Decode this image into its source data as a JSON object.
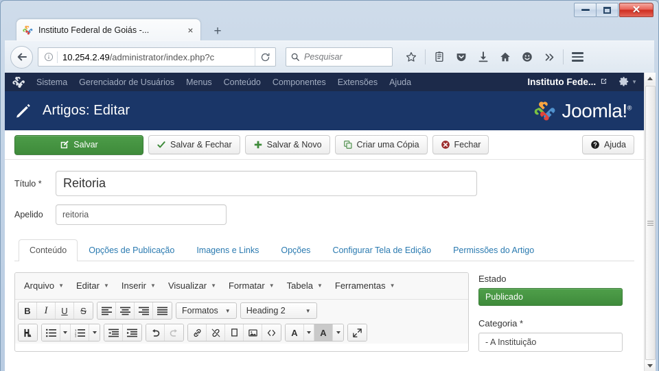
{
  "window": {
    "minimize_label": "Minimizar",
    "maximize_label": "Maximizar",
    "close_label": "Fechar"
  },
  "browser": {
    "tab": {
      "title": "Instituto Federal de Goiás -...",
      "favicon": "joomla-icon",
      "close_label": "×"
    },
    "new_tab_label": "+",
    "back_label": "←",
    "url": "10.254.2.49",
    "url_path": "/administrator/index.php?c",
    "reload_label": "⟳",
    "search_placeholder": "Pesquisar",
    "toolbar_icons": [
      "star-icon",
      "reader-list-icon",
      "pocket-icon",
      "download-icon",
      "home-icon",
      "smiley-icon",
      "overflow-chevrons-icon",
      "hamburger-menu-icon"
    ]
  },
  "joomla": {
    "nav": {
      "logo": "joomla-logo-icon",
      "items": [
        {
          "label": "Sistema"
        },
        {
          "label": "Gerenciador de Usuários"
        },
        {
          "label": "Menus"
        },
        {
          "label": "Conteúdo"
        },
        {
          "label": "Componentes"
        },
        {
          "label": "Extensões"
        },
        {
          "label": "Ajuda"
        }
      ],
      "site_name": "Instituto Fede...",
      "external_icon": "external-link-icon",
      "gear_icon": "gear-icon",
      "caret_icon": "chevron-down-icon"
    },
    "header": {
      "icon": "pencil-icon",
      "title": "Artigos: Editar",
      "brand": "Joomla!",
      "brand_sup": "®"
    },
    "toolbar": {
      "save": "Salvar",
      "save_close": "Salvar & Fechar",
      "save_new": "Salvar & Novo",
      "copy": "Criar uma Cópia",
      "close": "Fechar",
      "help": "Ajuda"
    },
    "form": {
      "title_label": "Título *",
      "title_value": "Reitoria",
      "alias_label": "Apelido",
      "alias_value": "reitoria"
    },
    "tabs": [
      {
        "label": "Conteúdo",
        "active": true
      },
      {
        "label": "Opções de Publicação",
        "active": false
      },
      {
        "label": "Imagens e Links",
        "active": false
      },
      {
        "label": "Opções",
        "active": false
      },
      {
        "label": "Configurar Tela de Edição",
        "active": false
      },
      {
        "label": "Permissões do Artigo",
        "active": false
      }
    ],
    "editor": {
      "menubar": [
        {
          "label": "Arquivo"
        },
        {
          "label": "Editar"
        },
        {
          "label": "Inserir"
        },
        {
          "label": "Visualizar"
        },
        {
          "label": "Formatar"
        },
        {
          "label": "Tabela"
        },
        {
          "label": "Ferramentas"
        }
      ],
      "format_select": "Formatos",
      "heading_select": "Heading 2",
      "row1_icons": [
        "bold-icon",
        "italic-icon",
        "underline-icon",
        "strikethrough-icon",
        "align-left-icon",
        "align-center-icon",
        "align-right-icon",
        "align-justify-icon"
      ],
      "row2_icons": [
        "search-replace-icon",
        "bullet-list-icon",
        "numbered-list-icon",
        "outdent-icon",
        "indent-icon",
        "undo-icon",
        "redo-icon",
        "link-icon",
        "unlink-icon",
        "anchor-icon",
        "image-icon",
        "source-code-icon",
        "text-color-icon",
        "background-color-icon",
        "fullscreen-icon"
      ]
    },
    "sidebar": {
      "status_label": "Estado",
      "status_value": "Publicado",
      "category_label": "Categoria *",
      "category_value": "- A Instituição"
    }
  },
  "colors": {
    "joomla_nav_bg": "#1c2a4a",
    "joomla_header_bg": "#1a3668",
    "primary_green": "#3f8b3b",
    "tab_link_blue": "#2a7ab0",
    "chrome_blue": "#c2d3e6"
  }
}
